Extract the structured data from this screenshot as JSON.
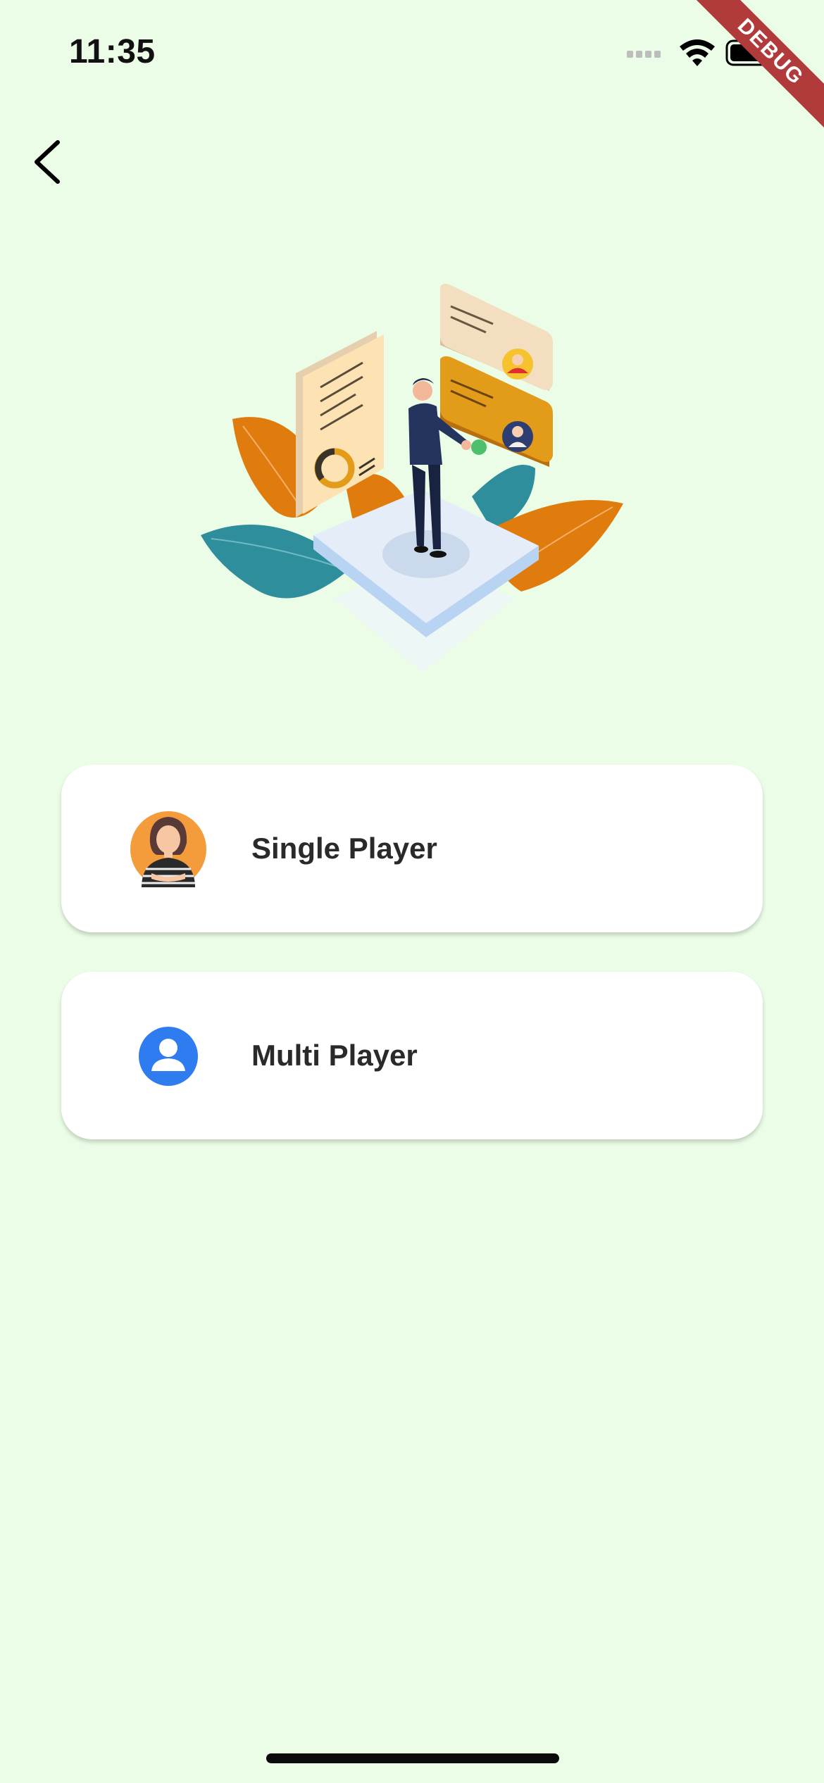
{
  "status_bar": {
    "time": "11:35",
    "icons": [
      "signal-icon",
      "wifi-icon",
      "battery-icon"
    ]
  },
  "debug_banner": {
    "label": "DEBUG",
    "color": "#b13a3a"
  },
  "nav": {
    "back_icon": "chevron-left-icon"
  },
  "hero": {
    "illustration": "businessman-dashboard-illustration"
  },
  "options": [
    {
      "label": "Single Player",
      "icon": "woman-avatar-icon",
      "icon_bg": "#f49b3b"
    },
    {
      "label": "Multi Player",
      "icon": "user-icon",
      "icon_bg": "#2f7cf0"
    }
  ],
  "colors": {
    "background": "#ebfde6",
    "card": "#ffffff",
    "text": "#2a2a2a"
  }
}
